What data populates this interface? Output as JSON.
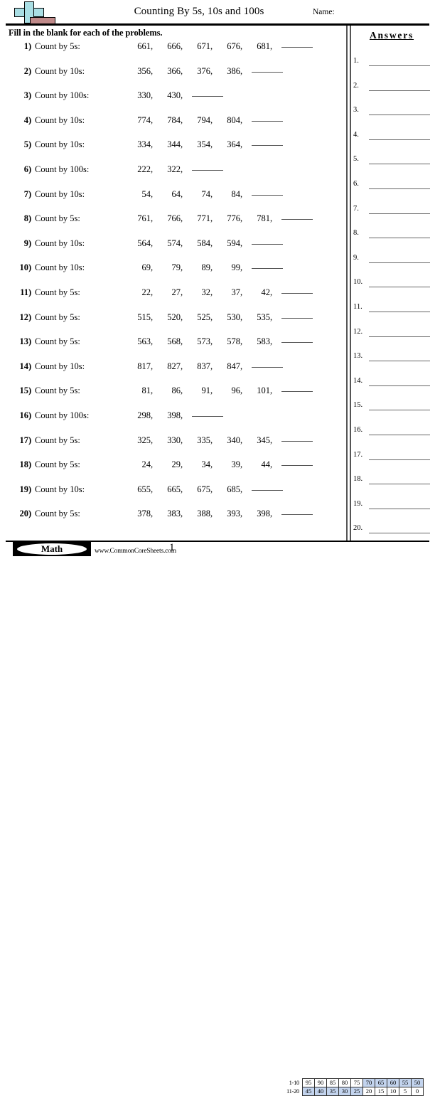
{
  "header": {
    "title": "Counting By 5s, 10s and 100s",
    "name_label": "Name:",
    "logo_icon": "plus-minus-math-icon"
  },
  "instructions": "Fill in the blank for each of the problems.",
  "answers": {
    "title": "Answers",
    "items": [
      {
        "number": "1."
      },
      {
        "number": "2."
      },
      {
        "number": "3."
      },
      {
        "number": "4."
      },
      {
        "number": "5."
      },
      {
        "number": "6."
      },
      {
        "number": "7."
      },
      {
        "number": "8."
      },
      {
        "number": "9."
      },
      {
        "number": "10."
      },
      {
        "number": "11."
      },
      {
        "number": "12."
      },
      {
        "number": "13."
      },
      {
        "number": "14."
      },
      {
        "number": "15."
      },
      {
        "number": "16."
      },
      {
        "number": "17."
      },
      {
        "number": "18."
      },
      {
        "number": "19."
      },
      {
        "number": "20."
      }
    ]
  },
  "problems": [
    {
      "number": "1",
      "label": "Count by 5s:",
      "terms": [
        "661",
        "666",
        "671",
        "676",
        "681"
      ]
    },
    {
      "number": "2",
      "label": "Count by 10s:",
      "terms": [
        "356",
        "366",
        "376",
        "386"
      ]
    },
    {
      "number": "3",
      "label": "Count by 100s:",
      "terms": [
        "330",
        "430"
      ]
    },
    {
      "number": "4",
      "label": "Count by 10s:",
      "terms": [
        "774",
        "784",
        "794",
        "804"
      ]
    },
    {
      "number": "5",
      "label": "Count by 10s:",
      "terms": [
        "334",
        "344",
        "354",
        "364"
      ]
    },
    {
      "number": "6",
      "label": "Count by 100s:",
      "terms": [
        "222",
        "322"
      ]
    },
    {
      "number": "7",
      "label": "Count by 10s:",
      "terms": [
        "54",
        "64",
        "74",
        "84"
      ]
    },
    {
      "number": "8",
      "label": "Count by 5s:",
      "terms": [
        "761",
        "766",
        "771",
        "776",
        "781"
      ]
    },
    {
      "number": "9",
      "label": "Count by 10s:",
      "terms": [
        "564",
        "574",
        "584",
        "594"
      ]
    },
    {
      "number": "10",
      "label": "Count by 10s:",
      "terms": [
        "69",
        "79",
        "89",
        "99"
      ]
    },
    {
      "number": "11",
      "label": "Count by 5s:",
      "terms": [
        "22",
        "27",
        "32",
        "37",
        "42"
      ]
    },
    {
      "number": "12",
      "label": "Count by 5s:",
      "terms": [
        "515",
        "520",
        "525",
        "530",
        "535"
      ]
    },
    {
      "number": "13",
      "label": "Count by 5s:",
      "terms": [
        "563",
        "568",
        "573",
        "578",
        "583"
      ]
    },
    {
      "number": "14",
      "label": "Count by 10s:",
      "terms": [
        "817",
        "827",
        "837",
        "847"
      ]
    },
    {
      "number": "15",
      "label": "Count by 5s:",
      "terms": [
        "81",
        "86",
        "91",
        "96",
        "101"
      ]
    },
    {
      "number": "16",
      "label": "Count by 100s:",
      "terms": [
        "298",
        "398"
      ]
    },
    {
      "number": "17",
      "label": "Count by 5s:",
      "terms": [
        "325",
        "330",
        "335",
        "340",
        "345"
      ]
    },
    {
      "number": "18",
      "label": "Count by 5s:",
      "terms": [
        "24",
        "29",
        "34",
        "39",
        "44"
      ]
    },
    {
      "number": "19",
      "label": "Count by 10s:",
      "terms": [
        "655",
        "665",
        "675",
        "685"
      ]
    },
    {
      "number": "20",
      "label": "Count by 5s:",
      "terms": [
        "378",
        "383",
        "388",
        "393",
        "398"
      ]
    }
  ],
  "footer": {
    "badge_label": "Math",
    "site_url": "www.CommonCoreSheets.com",
    "page_number": "1"
  },
  "score_table": {
    "rows": [
      {
        "label": "1-10",
        "cells": [
          {
            "value": "95",
            "highlighted": false
          },
          {
            "value": "90",
            "highlighted": false
          },
          {
            "value": "85",
            "highlighted": false
          },
          {
            "value": "80",
            "highlighted": false
          },
          {
            "value": "75",
            "highlighted": false
          },
          {
            "value": "70",
            "highlighted": true
          },
          {
            "value": "65",
            "highlighted": true
          },
          {
            "value": "60",
            "highlighted": true
          },
          {
            "value": "55",
            "highlighted": true
          },
          {
            "value": "50",
            "highlighted": true
          }
        ]
      },
      {
        "label": "11-20",
        "cells": [
          {
            "value": "45",
            "highlighted": true
          },
          {
            "value": "40",
            "highlighted": true
          },
          {
            "value": "35",
            "highlighted": true
          },
          {
            "value": "30",
            "highlighted": true
          },
          {
            "value": "25",
            "highlighted": true
          },
          {
            "value": "20",
            "highlighted": false
          },
          {
            "value": "15",
            "highlighted": false
          },
          {
            "value": "10",
            "highlighted": false
          },
          {
            "value": "5",
            "highlighted": false
          },
          {
            "value": "0",
            "highlighted": false
          }
        ]
      }
    ],
    "highlight_color": "#c3d4ee"
  }
}
